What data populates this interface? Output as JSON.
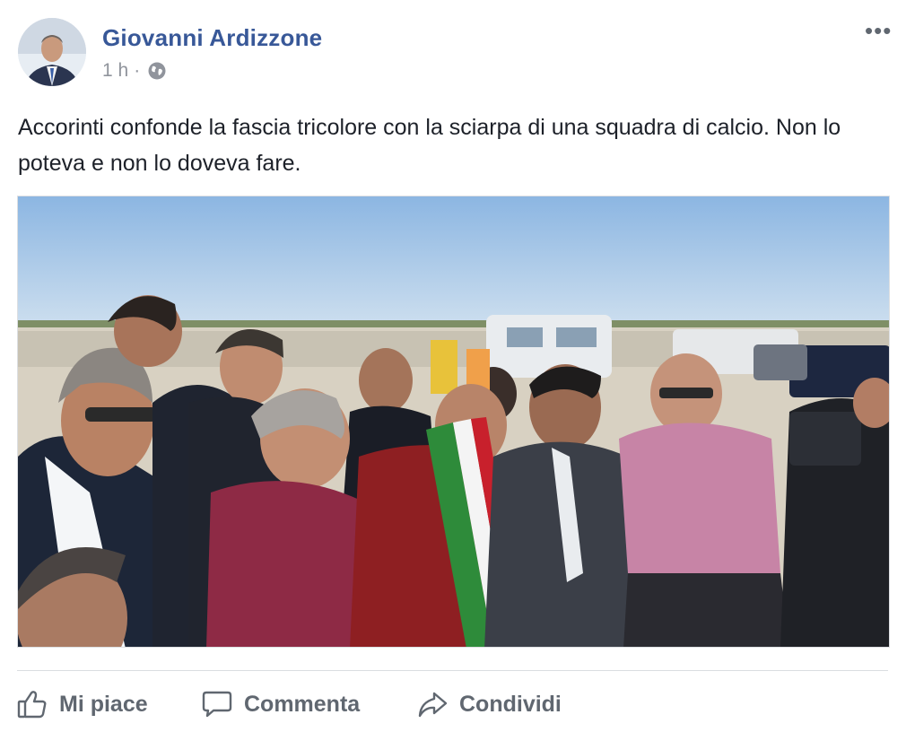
{
  "post": {
    "author": "Giovanni Ardizzone",
    "time": "1 h",
    "separator": "·",
    "privacy_icon": "globe-icon",
    "more_icon": "more-dots-icon",
    "more_label": "•••",
    "text": "Accorinti confonde la fascia tricolore con la sciarpa di una squadra di calcio. Non lo poteva e non lo doveva fare."
  },
  "actions": {
    "like_label": "Mi piace",
    "like_icon": "thumbs-up-icon",
    "comment_label": "Commenta",
    "comment_icon": "comment-bubble-icon",
    "share_label": "Condividi",
    "share_icon": "share-arrow-icon"
  },
  "colors": {
    "author": "#385898",
    "meta": "#90949c",
    "action_text": "#606770",
    "sash_green": "#2e8b3a",
    "sash_white": "#f4f4f4",
    "sash_red": "#c8202c"
  }
}
